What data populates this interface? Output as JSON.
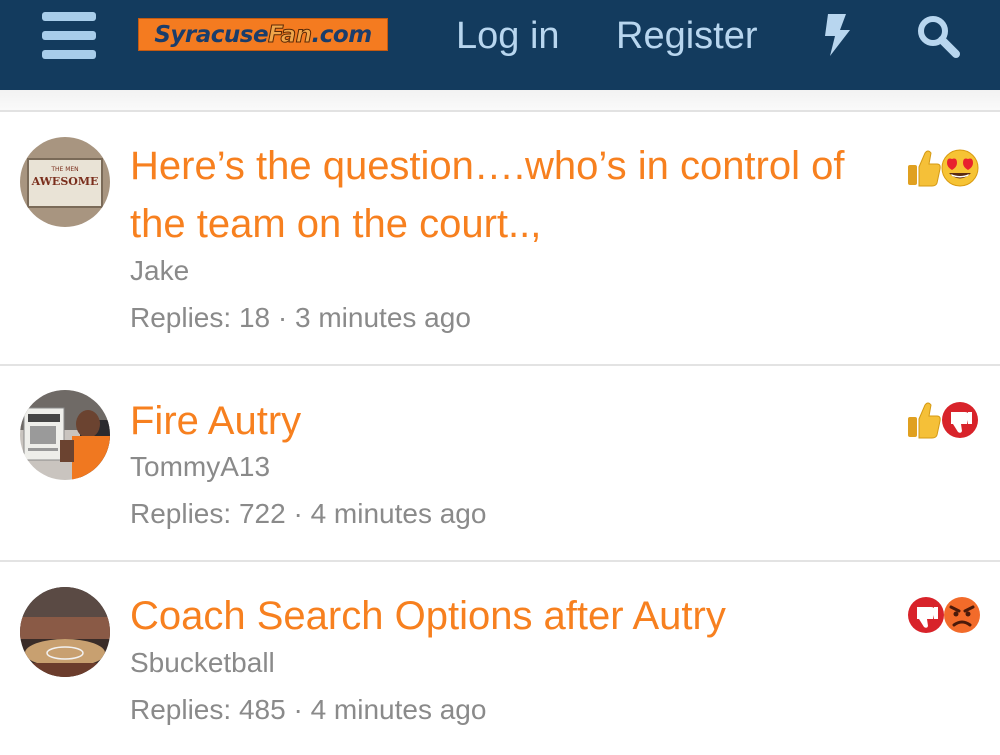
{
  "header": {
    "logo": {
      "part1": "Syracuse",
      "part2": "Fan",
      "part3": ".com"
    },
    "login": "Log in",
    "register": "Register",
    "icons": [
      "menu-icon",
      "bolt-icon",
      "search-icon"
    ]
  },
  "threads": [
    {
      "title": "Here’s the question….who’s in control of the team on the court..,",
      "author": "Jake",
      "replies_label": "Replies:",
      "replies": "18",
      "separator": "·",
      "time": "3 minutes ago",
      "avatar_text": [
        "THE MEN",
        "AWESOME"
      ],
      "reactions": [
        "thumbs-up-icon",
        "heart-eyes-icon"
      ]
    },
    {
      "title": "Fire Autry",
      "author": "TommyA13",
      "replies_label": "Replies:",
      "replies": "722",
      "separator": "·",
      "time": "4 minutes ago",
      "reactions": [
        "thumbs-up-icon",
        "thumbs-down-icon"
      ]
    },
    {
      "title": "Coach Search Options after Autry",
      "author": "Sbucketball",
      "replies_label": "Replies:",
      "replies": "485",
      "separator": "·",
      "time": "4 minutes ago",
      "reactions": [
        "thumbs-down-icon",
        "angry-icon"
      ]
    }
  ],
  "colors": {
    "header": "#133b5e",
    "nav_text": "#b8d6ef",
    "title": "#f7801f",
    "meta": "#8a8a8a",
    "logo_bg": "#f47b20"
  }
}
